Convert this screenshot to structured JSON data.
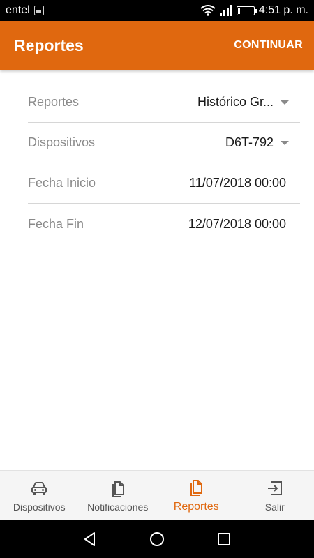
{
  "status_bar": {
    "carrier": "entel",
    "time": "4:51 p. m.",
    "icons": [
      "gallery-notification-icon",
      "wifi-icon",
      "signal-icon",
      "battery-icon"
    ]
  },
  "app_bar": {
    "title": "Reportes",
    "action_label": "CONTINUAR",
    "color": "#E0680F"
  },
  "form": {
    "rows": [
      {
        "label": "Reportes",
        "value": "Histórico Gr...",
        "dropdown": true
      },
      {
        "label": "Dispositivos",
        "value": "D6T-792",
        "dropdown": true
      },
      {
        "label": "Fecha Inicio",
        "value": "11/07/2018 00:00",
        "dropdown": false
      },
      {
        "label": "Fecha Fin",
        "value": "12/07/2018 00:00",
        "dropdown": false
      }
    ]
  },
  "bottom_nav": {
    "items": [
      {
        "label": "Dispositivos",
        "icon": "car-icon",
        "active": false
      },
      {
        "label": "Notificaciones",
        "icon": "document-icon",
        "active": false
      },
      {
        "label": "Reportes",
        "icon": "document-icon",
        "active": true
      },
      {
        "label": "Salir",
        "icon": "exit-icon",
        "active": false
      }
    ]
  },
  "system_nav": {
    "icons": [
      "back-icon",
      "home-icon",
      "recents-icon"
    ]
  }
}
